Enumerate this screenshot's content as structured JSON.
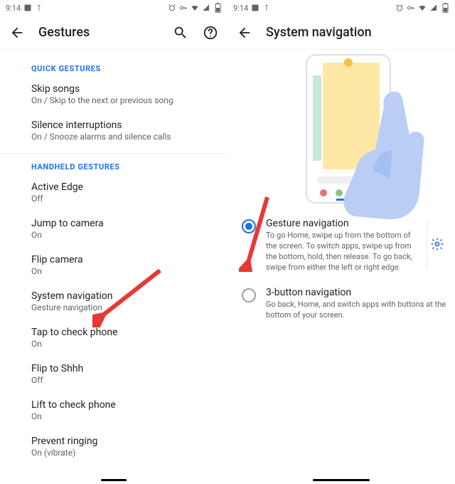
{
  "status": {
    "time": "9:14"
  },
  "left": {
    "title": "Gestures",
    "section1": "QUICK GESTURES",
    "skip": {
      "title": "Skip songs",
      "sub": "On / Skip to the next or previous song"
    },
    "silence": {
      "title": "Silence interruptions",
      "sub": "On / Snooze alarms and silence calls"
    },
    "section2": "HANDHELD GESTURES",
    "edge": {
      "title": "Active Edge",
      "sub": "Off"
    },
    "jump": {
      "title": "Jump to camera",
      "sub": "On"
    },
    "flip": {
      "title": "Flip camera",
      "sub": "On"
    },
    "sysnav": {
      "title": "System navigation",
      "sub": "Gesture navigation"
    },
    "tap": {
      "title": "Tap to check phone",
      "sub": "On"
    },
    "shhh": {
      "title": "Flip to Shhh",
      "sub": "Off"
    },
    "lift": {
      "title": "Lift to check phone",
      "sub": "On"
    },
    "ring": {
      "title": "Prevent ringing",
      "sub": "On (vibrate)"
    }
  },
  "right": {
    "title": "System navigation",
    "opt1": {
      "title": "Gesture navigation",
      "desc": "To go Home, swipe up from the bottom of the screen. To switch apps, swipe up from the bottom, hold, then release. To go back, swipe from either the left or right edge."
    },
    "opt2": {
      "title": "3-button navigation",
      "desc": "Go back, Home, and switch apps with buttons at the bottom of your screen."
    }
  }
}
